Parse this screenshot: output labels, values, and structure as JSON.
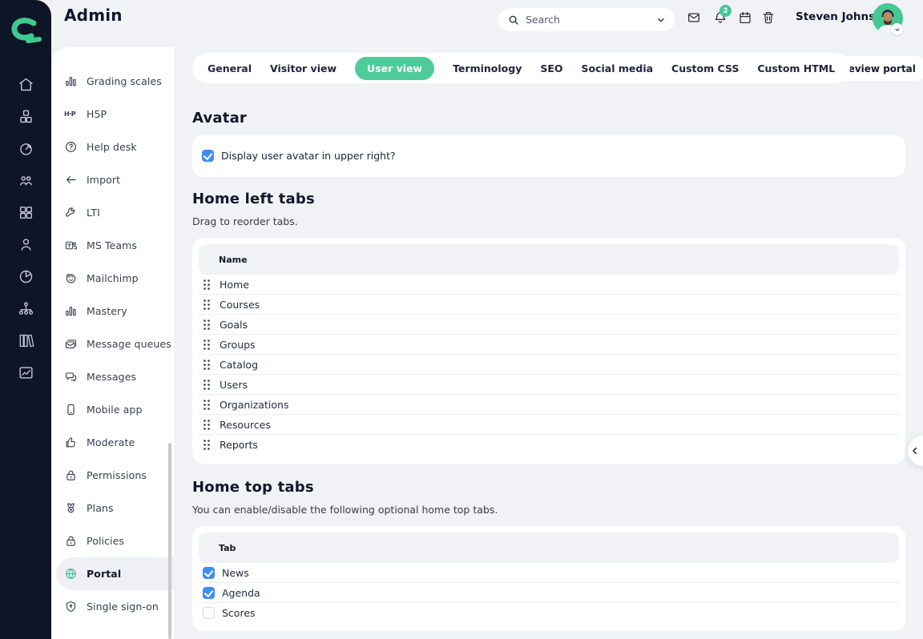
{
  "app": {
    "title": "Admin",
    "logo": "cypher-logo"
  },
  "colors": {
    "rail_bg": "#0D1526",
    "page_bg": "#F1F2F6",
    "accent_green": "#4FCB9B",
    "logo_green": "#3FC98E",
    "checkbox_blue": "#3E8DF3",
    "heading_text": "#11162A"
  },
  "topbar": {
    "search": {
      "placeholder": "Search"
    },
    "notifications_badge": "2",
    "icons": [
      "mail",
      "bell",
      "calendar",
      "trash"
    ],
    "user": {
      "name": "Steven Johnson"
    }
  },
  "rail": {
    "icons": [
      "home",
      "cubes",
      "target",
      "people-group",
      "grid",
      "person",
      "pie-chart",
      "hierarchy",
      "books",
      "line-chart"
    ]
  },
  "sidebar": {
    "items": [
      {
        "label": "Grading scales",
        "icon": "bar-chart",
        "active": false
      },
      {
        "label": "H5P",
        "icon": "h5p-logo",
        "active": false
      },
      {
        "label": "Help desk",
        "icon": "question-circle",
        "active": false
      },
      {
        "label": "Import",
        "icon": "arrow-left",
        "active": false
      },
      {
        "label": "LTI",
        "icon": "wrench",
        "active": false
      },
      {
        "label": "MS Teams",
        "icon": "teams-logo",
        "active": false
      },
      {
        "label": "Mailchimp",
        "icon": "mailchimp-logo",
        "active": false
      },
      {
        "label": "Mastery",
        "icon": "bar-chart",
        "active": false
      },
      {
        "label": "Message queues",
        "icon": "mail-stack",
        "active": false
      },
      {
        "label": "Messages",
        "icon": "chat-bubbles",
        "active": false
      },
      {
        "label": "Mobile app",
        "icon": "phone",
        "active": false
      },
      {
        "label": "Moderate",
        "icon": "thumbs-up",
        "active": false
      },
      {
        "label": "Permissions",
        "icon": "lock",
        "active": false
      },
      {
        "label": "Plans",
        "icon": "medal",
        "active": false
      },
      {
        "label": "Policies",
        "icon": "lock",
        "active": false
      },
      {
        "label": "Portal",
        "icon": "globe",
        "active": true
      },
      {
        "label": "Single sign-on",
        "icon": "shield",
        "active": false
      }
    ]
  },
  "tabs": {
    "items": [
      {
        "label": "General",
        "active": false
      },
      {
        "label": "Visitor view",
        "active": false
      },
      {
        "label": "User view",
        "active": true
      },
      {
        "label": "Terminology",
        "active": false
      },
      {
        "label": "SEO",
        "active": false
      },
      {
        "label": "Social media",
        "active": false
      },
      {
        "label": "Custom CSS",
        "active": false
      },
      {
        "label": "Custom HTML",
        "active": false
      }
    ],
    "more_label": "⋮"
  },
  "preview": {
    "label": "Preview portal",
    "icon": "globe"
  },
  "sections": {
    "avatar": {
      "title": "Avatar",
      "checkbox_label": "Display user avatar in upper right?",
      "checked": true
    },
    "home_left_tabs": {
      "title": "Home left tabs",
      "subtitle": "Drag to reorder tabs.",
      "column_header": "Name",
      "rows": [
        "Home",
        "Courses",
        "Goals",
        "Groups",
        "Catalog",
        "Users",
        "Organizations",
        "Resources",
        "Reports"
      ]
    },
    "home_top_tabs": {
      "title": "Home top tabs",
      "subtitle": "You can enable/disable the following optional home top tabs.",
      "column_header": "Tab",
      "rows": [
        {
          "label": "News",
          "checked": true
        },
        {
          "label": "Agenda",
          "checked": true
        },
        {
          "label": "Scores",
          "checked": false
        }
      ]
    }
  }
}
